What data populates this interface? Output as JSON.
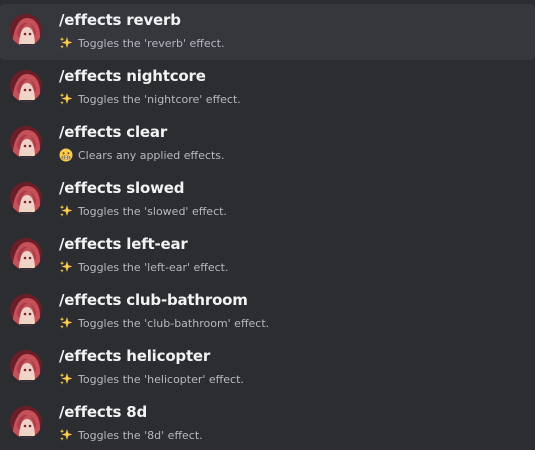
{
  "commands": [
    {
      "name": "/effects reverb",
      "icon": "sparkles-icon",
      "description": "Toggles the 'reverb' effect.",
      "selected": true
    },
    {
      "name": "/effects nightcore",
      "icon": "sparkles-icon",
      "description": "Toggles the 'nightcore' effect.",
      "selected": false
    },
    {
      "name": "/effects clear",
      "icon": "grimacing-face-icon",
      "description": "Clears any applied effects.",
      "selected": false
    },
    {
      "name": "/effects slowed",
      "icon": "sparkles-icon",
      "description": "Toggles the 'slowed' effect.",
      "selected": false
    },
    {
      "name": "/effects left-ear",
      "icon": "sparkles-icon",
      "description": "Toggles the 'left-ear' effect.",
      "selected": false
    },
    {
      "name": "/effects club-bathroom",
      "icon": "sparkles-icon",
      "description": "Toggles the 'club-bathroom' effect.",
      "selected": false
    },
    {
      "name": "/effects helicopter",
      "icon": "sparkles-icon",
      "description": "Toggles the 'helicopter' effect.",
      "selected": false
    },
    {
      "name": "/effects 8d",
      "icon": "sparkles-icon",
      "description": "Toggles the '8d' effect.",
      "selected": false
    }
  ],
  "colors": {
    "background": "#2b2d31",
    "selected_row": "#35373c",
    "command_text": "#f2f3f5",
    "description_text": "#b5bac1"
  }
}
